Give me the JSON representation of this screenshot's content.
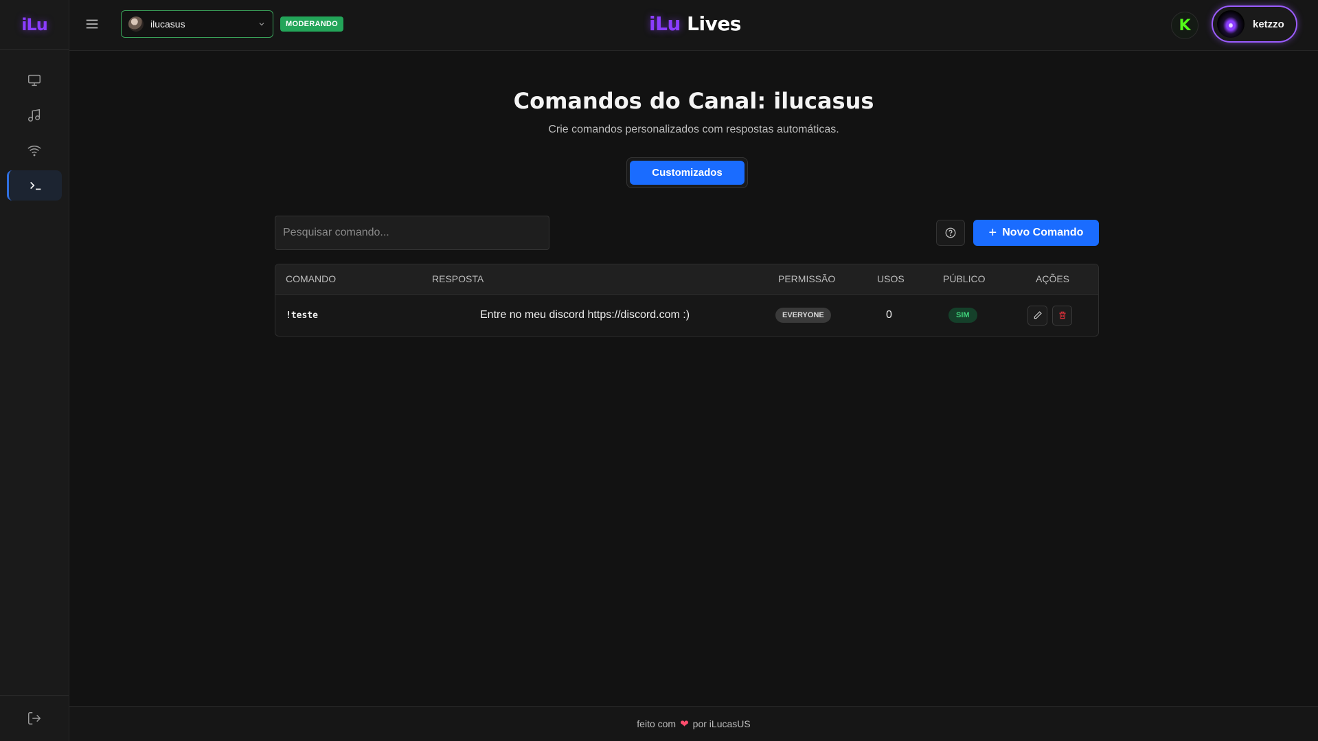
{
  "sidebar": {
    "logo_text": "iLu",
    "items": [
      {
        "name": "monitor-icon"
      },
      {
        "name": "music-icon"
      },
      {
        "name": "wifi-icon"
      },
      {
        "name": "terminal-icon",
        "active": true
      }
    ],
    "logout_icon": "logout-icon"
  },
  "header": {
    "channel": "ilucasus",
    "mod_badge": "MODERANDO",
    "brand_part1": "iLu",
    "brand_part2": "Lives",
    "kick_label": "K",
    "user_name": "ketzzo"
  },
  "main": {
    "title": "Comandos do Canal: ilucasus",
    "subtitle": "Crie comandos personalizados com respostas automáticas.",
    "tab_label": "Customizados",
    "search_placeholder": "Pesquisar comando...",
    "new_button": "Novo Comando"
  },
  "table": {
    "headers": {
      "command": "COMANDO",
      "response": "RESPOSTA",
      "permission": "PERMISSÃO",
      "uses": "USOS",
      "public": "PÚBLICO",
      "actions": "AÇÕES"
    },
    "rows": [
      {
        "command": "!teste",
        "response": "Entre no meu discord https://discord.com :)",
        "permission": "EVERYONE",
        "uses": "0",
        "public": "SIM"
      }
    ]
  },
  "footer": {
    "text_before": "feito com",
    "text_after": "por iLucasUS"
  },
  "colors": {
    "accent_blue": "#1a6cff",
    "brand_purple": "#8b3dff",
    "moderating_green": "#23a559",
    "kick_green": "#53fc18",
    "delete_red": "#e0303a"
  }
}
